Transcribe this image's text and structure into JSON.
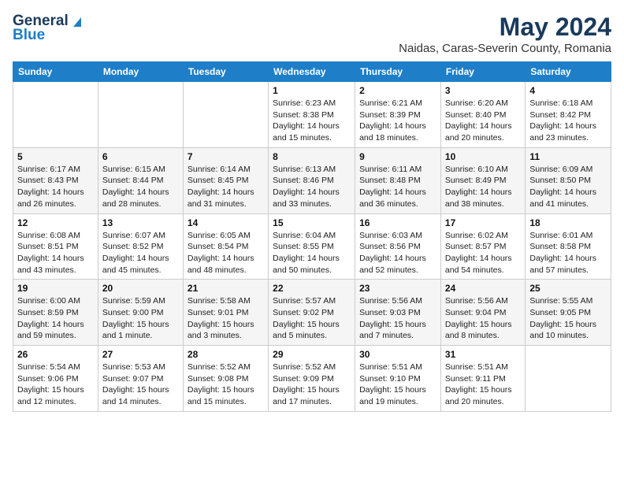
{
  "logo": {
    "line1": "General",
    "line2": "Blue"
  },
  "title": "May 2024",
  "subtitle": "Naidas, Caras-Severin County, Romania",
  "header_days": [
    "Sunday",
    "Monday",
    "Tuesday",
    "Wednesday",
    "Thursday",
    "Friday",
    "Saturday"
  ],
  "weeks": [
    [
      {
        "day": "",
        "text": ""
      },
      {
        "day": "",
        "text": ""
      },
      {
        "day": "",
        "text": ""
      },
      {
        "day": "1",
        "text": "Sunrise: 6:23 AM\nSunset: 8:38 PM\nDaylight: 14 hours\nand 15 minutes."
      },
      {
        "day": "2",
        "text": "Sunrise: 6:21 AM\nSunset: 8:39 PM\nDaylight: 14 hours\nand 18 minutes."
      },
      {
        "day": "3",
        "text": "Sunrise: 6:20 AM\nSunset: 8:40 PM\nDaylight: 14 hours\nand 20 minutes."
      },
      {
        "day": "4",
        "text": "Sunrise: 6:18 AM\nSunset: 8:42 PM\nDaylight: 14 hours\nand 23 minutes."
      }
    ],
    [
      {
        "day": "5",
        "text": "Sunrise: 6:17 AM\nSunset: 8:43 PM\nDaylight: 14 hours\nand 26 minutes."
      },
      {
        "day": "6",
        "text": "Sunrise: 6:15 AM\nSunset: 8:44 PM\nDaylight: 14 hours\nand 28 minutes."
      },
      {
        "day": "7",
        "text": "Sunrise: 6:14 AM\nSunset: 8:45 PM\nDaylight: 14 hours\nand 31 minutes."
      },
      {
        "day": "8",
        "text": "Sunrise: 6:13 AM\nSunset: 8:46 PM\nDaylight: 14 hours\nand 33 minutes."
      },
      {
        "day": "9",
        "text": "Sunrise: 6:11 AM\nSunset: 8:48 PM\nDaylight: 14 hours\nand 36 minutes."
      },
      {
        "day": "10",
        "text": "Sunrise: 6:10 AM\nSunset: 8:49 PM\nDaylight: 14 hours\nand 38 minutes."
      },
      {
        "day": "11",
        "text": "Sunrise: 6:09 AM\nSunset: 8:50 PM\nDaylight: 14 hours\nand 41 minutes."
      }
    ],
    [
      {
        "day": "12",
        "text": "Sunrise: 6:08 AM\nSunset: 8:51 PM\nDaylight: 14 hours\nand 43 minutes."
      },
      {
        "day": "13",
        "text": "Sunrise: 6:07 AM\nSunset: 8:52 PM\nDaylight: 14 hours\nand 45 minutes."
      },
      {
        "day": "14",
        "text": "Sunrise: 6:05 AM\nSunset: 8:54 PM\nDaylight: 14 hours\nand 48 minutes."
      },
      {
        "day": "15",
        "text": "Sunrise: 6:04 AM\nSunset: 8:55 PM\nDaylight: 14 hours\nand 50 minutes."
      },
      {
        "day": "16",
        "text": "Sunrise: 6:03 AM\nSunset: 8:56 PM\nDaylight: 14 hours\nand 52 minutes."
      },
      {
        "day": "17",
        "text": "Sunrise: 6:02 AM\nSunset: 8:57 PM\nDaylight: 14 hours\nand 54 minutes."
      },
      {
        "day": "18",
        "text": "Sunrise: 6:01 AM\nSunset: 8:58 PM\nDaylight: 14 hours\nand 57 minutes."
      }
    ],
    [
      {
        "day": "19",
        "text": "Sunrise: 6:00 AM\nSunset: 8:59 PM\nDaylight: 14 hours\nand 59 minutes."
      },
      {
        "day": "20",
        "text": "Sunrise: 5:59 AM\nSunset: 9:00 PM\nDaylight: 15 hours\nand 1 minute."
      },
      {
        "day": "21",
        "text": "Sunrise: 5:58 AM\nSunset: 9:01 PM\nDaylight: 15 hours\nand 3 minutes."
      },
      {
        "day": "22",
        "text": "Sunrise: 5:57 AM\nSunset: 9:02 PM\nDaylight: 15 hours\nand 5 minutes."
      },
      {
        "day": "23",
        "text": "Sunrise: 5:56 AM\nSunset: 9:03 PM\nDaylight: 15 hours\nand 7 minutes."
      },
      {
        "day": "24",
        "text": "Sunrise: 5:56 AM\nSunset: 9:04 PM\nDaylight: 15 hours\nand 8 minutes."
      },
      {
        "day": "25",
        "text": "Sunrise: 5:55 AM\nSunset: 9:05 PM\nDaylight: 15 hours\nand 10 minutes."
      }
    ],
    [
      {
        "day": "26",
        "text": "Sunrise: 5:54 AM\nSunset: 9:06 PM\nDaylight: 15 hours\nand 12 minutes."
      },
      {
        "day": "27",
        "text": "Sunrise: 5:53 AM\nSunset: 9:07 PM\nDaylight: 15 hours\nand 14 minutes."
      },
      {
        "day": "28",
        "text": "Sunrise: 5:52 AM\nSunset: 9:08 PM\nDaylight: 15 hours\nand 15 minutes."
      },
      {
        "day": "29",
        "text": "Sunrise: 5:52 AM\nSunset: 9:09 PM\nDaylight: 15 hours\nand 17 minutes."
      },
      {
        "day": "30",
        "text": "Sunrise: 5:51 AM\nSunset: 9:10 PM\nDaylight: 15 hours\nand 19 minutes."
      },
      {
        "day": "31",
        "text": "Sunrise: 5:51 AM\nSunset: 9:11 PM\nDaylight: 15 hours\nand 20 minutes."
      },
      {
        "day": "",
        "text": ""
      }
    ]
  ]
}
